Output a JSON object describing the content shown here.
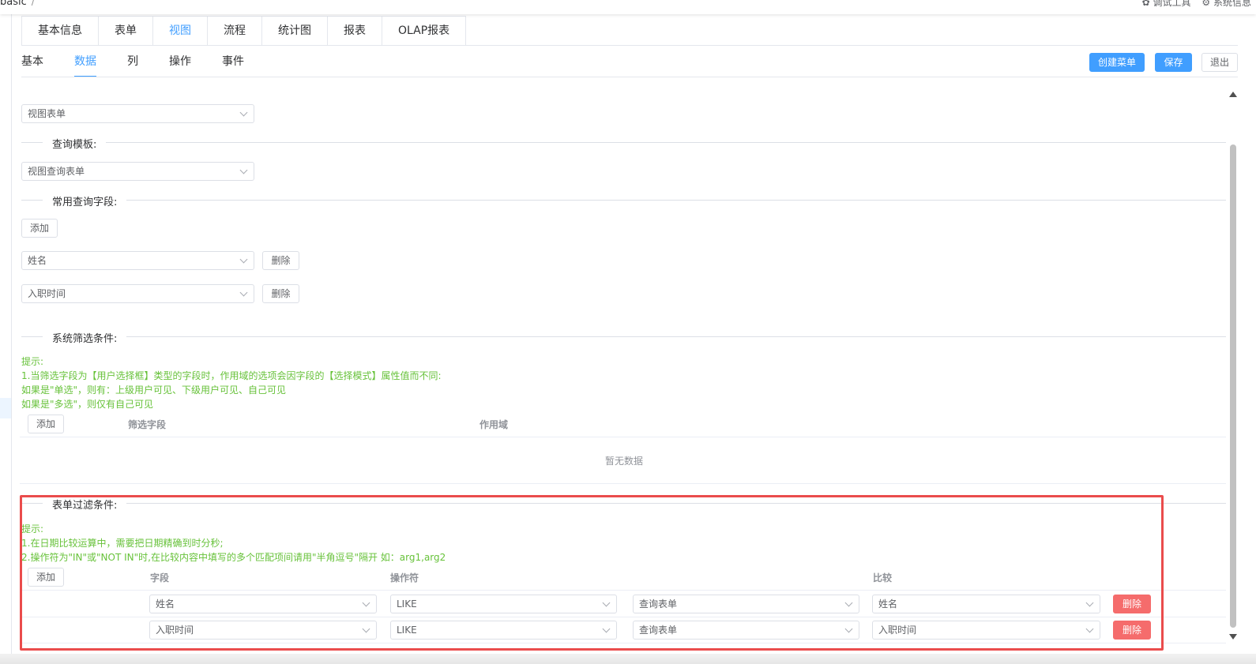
{
  "header": {
    "breadcrumb": "basic",
    "breadcrumb_sep": "/",
    "debug_tool": "调试工具",
    "system_info": "系统信息"
  },
  "main_tabs": [
    {
      "label": "基本信息",
      "active": false
    },
    {
      "label": "表单",
      "active": false
    },
    {
      "label": "视图",
      "active": true
    },
    {
      "label": "流程",
      "active": false
    },
    {
      "label": "统计图",
      "active": false
    },
    {
      "label": "报表",
      "active": false
    },
    {
      "label": "OLAP报表",
      "active": false
    }
  ],
  "sub_tabs": [
    {
      "label": "基本",
      "active": false
    },
    {
      "label": "数据",
      "active": true
    },
    {
      "label": "列",
      "active": false
    },
    {
      "label": "操作",
      "active": false
    },
    {
      "label": "事件",
      "active": false
    }
  ],
  "actions": {
    "create_menu": "创建菜单",
    "save": "保存",
    "exit": "退出"
  },
  "view_form_select": "视图表单",
  "query_template": {
    "title": "查询模板:",
    "value": "视图查询表单"
  },
  "common_fields": {
    "title": "常用查询字段:",
    "add": "添加",
    "items": [
      {
        "value": "姓名",
        "delete": "删除"
      },
      {
        "value": "入职时间",
        "delete": "删除"
      }
    ]
  },
  "system_filter": {
    "title": "系统筛选条件:",
    "hints": [
      "提示:",
      "1.当筛选字段为【用户选择框】类型的字段时，作用域的选项会因字段的【选择模式】属性值而不同:",
      "如果是\"单选\"，则有：上级用户可见、下级用户可见、自己可见",
      "如果是\"多选\"，则仅有自己可见"
    ],
    "add": "添加",
    "col_field": "筛选字段",
    "col_scope": "作用域",
    "empty_text": "暂无数据"
  },
  "form_filter": {
    "title": "表单过滤条件:",
    "hints": [
      "提示:",
      "1.在日期比较运算中，需要把日期精确到时分秒;",
      "2.操作符为\"IN\"或\"NOT IN\"时,在比较内容中填写的多个匹配项间请用\"半角逗号\"隔开 如：arg1,arg2"
    ],
    "add": "添加",
    "col_field": "字段",
    "col_operator": "操作符",
    "col_compare": "比较",
    "rows": [
      {
        "field": "姓名",
        "operator": "LIKE",
        "source": "查询表单",
        "compare": "姓名",
        "delete": "删除"
      },
      {
        "field": "入职时间",
        "operator": "LIKE",
        "source": "查询表单",
        "compare": "入职时间",
        "delete": "删除"
      }
    ]
  },
  "colors": {
    "primary": "#409eff",
    "danger": "#f56c6c",
    "hint": "#67c23a",
    "highlight_box": "#ea4c4c"
  },
  "icons": {
    "debug": "bug-icon",
    "system": "gear-icon",
    "select_arrow": "chevron-down-icon"
  }
}
